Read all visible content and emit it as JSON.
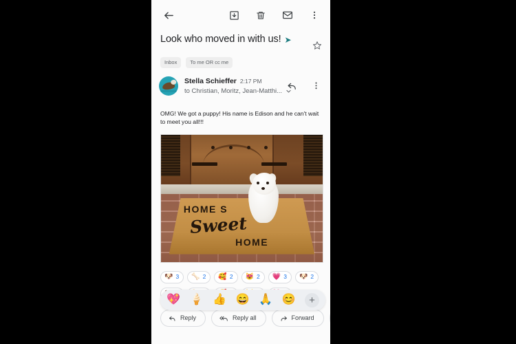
{
  "appbar": {
    "back_icon": "back-arrow-icon",
    "archive_icon": "archive-icon",
    "delete_icon": "trash-icon",
    "mark_unread_icon": "mail-icon",
    "more_icon": "more-vertical-icon"
  },
  "email": {
    "subject": "Look who moved in with us!",
    "subject_arrow": "➤",
    "star_icon": "star-outline-icon",
    "labels": [
      "Inbox",
      "To me OR cc me"
    ],
    "sender": {
      "name": "Stella Schieffer",
      "time": "2:17 PM",
      "recipients": "to Christian, Moritz, Jean-Matthi...",
      "expand_icon": "chevron-down-icon",
      "reply_icon": "reply-icon",
      "more_icon": "more-vertical-icon",
      "avatar_alt": "otter-avatar"
    },
    "body": "OMG! We got a puppy! His name is Edison and he can't wait to meet you all!!!",
    "attachment": {
      "alt": "white-puppy-on-home-sweet-home-doormat",
      "mat_text_line1": "HOME S",
      "mat_text_script": "Sweet",
      "mat_text_line2": "HOME"
    }
  },
  "reactions": [
    {
      "emoji": "🐶",
      "name": "dog-face",
      "count": "3"
    },
    {
      "emoji": "🦴",
      "name": "bone",
      "count": "2"
    },
    {
      "emoji": "🥰",
      "name": "smiling-face-with-hearts",
      "count": "2"
    },
    {
      "emoji": "😻",
      "name": "heart-eyes-cat",
      "count": "2"
    },
    {
      "emoji": "💗",
      "name": "growing-heart",
      "count": "3"
    },
    {
      "emoji": "🐶",
      "name": "dog-face-2",
      "count": "2"
    }
  ],
  "reactions_row2": [
    {
      "emoji": "🐶",
      "name": "dog-face",
      "count": "3"
    },
    {
      "emoji": "🦴",
      "name": "bone",
      "count": "2"
    },
    {
      "emoji": "🥰",
      "name": "smiling-face-with-hearts",
      "count": "2"
    },
    {
      "emoji": "😻",
      "name": "heart-eyes-cat",
      "count": "2"
    },
    {
      "emoji": "💗",
      "name": "growing-heart",
      "count": "3"
    }
  ],
  "emoji_bar": {
    "items": [
      {
        "emoji": "💖",
        "name": "sparkling-heart"
      },
      {
        "emoji": "🍦",
        "name": "ice-cream-cone"
      },
      {
        "emoji": "👍",
        "name": "thumbs-up"
      },
      {
        "emoji": "😄",
        "name": "grinning-face"
      },
      {
        "emoji": "🙏",
        "name": "folded-hands"
      },
      {
        "emoji": "😊",
        "name": "smiling-face"
      }
    ],
    "plus_label": "+"
  },
  "actions": {
    "reply": "Reply",
    "reply_all": "Reply all",
    "forward": "Forward",
    "emoji_button_icon": "emoji-smiley-icon"
  },
  "colors": {
    "accent": "#1a73e8",
    "subject_arrow": "#1b7b7f",
    "avatar_bg": "#25a3b5",
    "screen_bg": "#fbfbfb",
    "frame_bg": "#000000"
  }
}
